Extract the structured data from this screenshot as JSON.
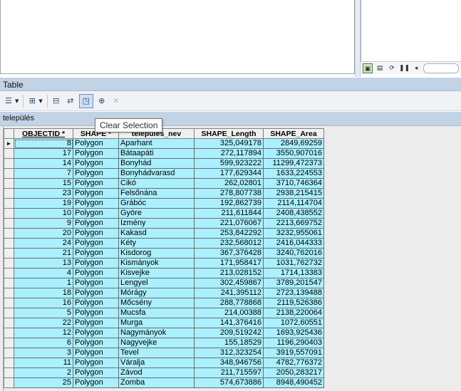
{
  "table_window": {
    "title": "Table"
  },
  "tab": {
    "name": "település"
  },
  "tooltip": {
    "text": "Clear Selection"
  },
  "current_row_marker": "►",
  "columns": [
    "OBJECTID *",
    "SHAPE *",
    "település_nev",
    "SHAPE_Length",
    "SHAPE_Area"
  ],
  "rows": [
    {
      "oid": "8",
      "shape": "Polygon",
      "nev": "Aparhant",
      "length": "325,049178",
      "area": "2849,69259"
    },
    {
      "oid": "17",
      "shape": "Polygon",
      "nev": "Bátaapáti",
      "length": "272,117894",
      "area": "3550,907016"
    },
    {
      "oid": "14",
      "shape": "Polygon",
      "nev": "Bonyhád",
      "length": "599,923222",
      "area": "11299,472373"
    },
    {
      "oid": "7",
      "shape": "Polygon",
      "nev": "Bonyhádvarasd",
      "length": "177,629344",
      "area": "1633,224553"
    },
    {
      "oid": "15",
      "shape": "Polygon",
      "nev": "Cikó",
      "length": "262,02801",
      "area": "3710,746364"
    },
    {
      "oid": "23",
      "shape": "Polygon",
      "nev": "Felsőnána",
      "length": "278,807738",
      "area": "2938,215415"
    },
    {
      "oid": "19",
      "shape": "Polygon",
      "nev": "Grábóc",
      "length": "192,862739",
      "area": "2114,114704"
    },
    {
      "oid": "10",
      "shape": "Polygon",
      "nev": "Györe",
      "length": "211,611844",
      "area": "2408,438552"
    },
    {
      "oid": "9",
      "shape": "Polygon",
      "nev": "Izmény",
      "length": "221,076067",
      "area": "2213,669752"
    },
    {
      "oid": "20",
      "shape": "Polygon",
      "nev": "Kakasd",
      "length": "253,842292",
      "area": "3232,955061"
    },
    {
      "oid": "24",
      "shape": "Polygon",
      "nev": "Kéty",
      "length": "232,568012",
      "area": "2416,044333"
    },
    {
      "oid": "21",
      "shape": "Polygon",
      "nev": "Kisdorog",
      "length": "367,376428",
      "area": "3240,762016"
    },
    {
      "oid": "13",
      "shape": "Polygon",
      "nev": "Kismányok",
      "length": "171,958417",
      "area": "1031,762732"
    },
    {
      "oid": "4",
      "shape": "Polygon",
      "nev": "Kisvejke",
      "length": "213,028152",
      "area": "1714,13383"
    },
    {
      "oid": "1",
      "shape": "Polygon",
      "nev": "Lengyel",
      "length": "302,459867",
      "area": "3789,201547"
    },
    {
      "oid": "18",
      "shape": "Polygon",
      "nev": "Mórágy",
      "length": "241,395112",
      "area": "2723,139488"
    },
    {
      "oid": "16",
      "shape": "Polygon",
      "nev": "Mőcsény",
      "length": "288,778868",
      "area": "2119,526386"
    },
    {
      "oid": "5",
      "shape": "Polygon",
      "nev": "Mucsfa",
      "length": "214,00388",
      "area": "2138,220064"
    },
    {
      "oid": "22",
      "shape": "Polygon",
      "nev": "Murga",
      "length": "141,376416",
      "area": "1072,60551"
    },
    {
      "oid": "12",
      "shape": "Polygon",
      "nev": "Nagymányok",
      "length": "209,519242",
      "area": "1693,925436"
    },
    {
      "oid": "6",
      "shape": "Polygon",
      "nev": "Nagyvejke",
      "length": "155,18529",
      "area": "1196,290403"
    },
    {
      "oid": "3",
      "shape": "Polygon",
      "nev": "Tevel",
      "length": "312,323254",
      "area": "3919,557091"
    },
    {
      "oid": "11",
      "shape": "Polygon",
      "nev": "Váralja",
      "length": "348,946756",
      "area": "4782,776372"
    },
    {
      "oid": "2",
      "shape": "Polygon",
      "nev": "Závod",
      "length": "211,715597",
      "area": "2050,283217"
    },
    {
      "oid": "25",
      "shape": "Polygon",
      "nev": "Zomba",
      "length": "574,673886",
      "area": "8948,490452"
    }
  ],
  "icons": {
    "table_options": "table-options-icon",
    "related_tables": "related-tables-icon",
    "select_by_attributes": "select-by-attributes-icon",
    "switch_selection": "switch-selection-icon",
    "clear_selection": "clear-selection-icon",
    "zoom_to_selected": "zoom-to-selected-icon",
    "delete_selected": "delete-icon",
    "layout_view": "layout-view-icon",
    "data_view": "data-view-icon",
    "refresh": "refresh-icon",
    "pause": "pause-icon",
    "scroll_left": "arrow-left-icon"
  },
  "colors": {
    "selected_row_bg": "#aaf0ff",
    "title_bar_bg": "#c2d3e6"
  }
}
